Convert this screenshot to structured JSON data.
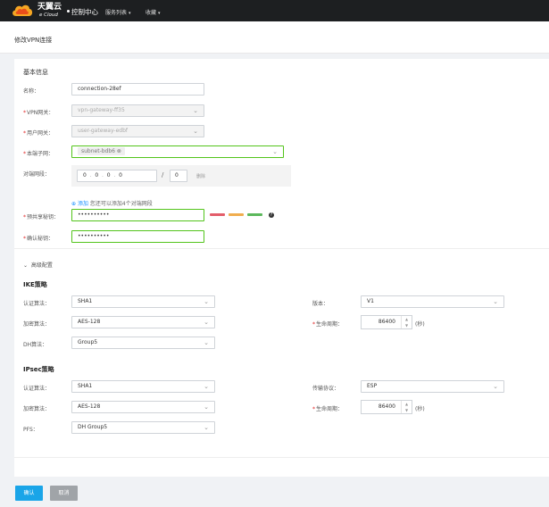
{
  "topbar": {
    "logo_cn": "天翼云",
    "logo_en": "e Cloud",
    "console": "控制中心",
    "nav": [
      {
        "label": "服务列表"
      },
      {
        "label": "收藏"
      }
    ]
  },
  "page": {
    "title": "修改VPN连接"
  },
  "basic": {
    "title": "基本信息",
    "name_label": "名称：",
    "name_value": "connection-28ef",
    "vpn_gw_label": "VPN网关：",
    "vpn_gw_value": "vpn-gateway-ff35",
    "user_gw_label": "用户网关：",
    "user_gw_value": "user-gateway-edbf",
    "local_subnet_label": "本端子网：",
    "local_subnet_chip": "subnet-bdb6",
    "local_subnet_chip_close": "⊗",
    "peer_cidr_label": "对端网段：",
    "cidr_octets": [
      "0",
      "0",
      "0",
      "0"
    ],
    "cidr_mask": "0",
    "delete_label": "删除",
    "add_link": "添加",
    "add_hint": "您还可以添加4个对端网段",
    "psk_label": "预共享秘钥：",
    "psk_value": "••••••••••",
    "confirm_label": "确认秘钥：",
    "confirm_value": "••••••••••",
    "help_glyph": "?",
    "strength_colors": [
      "#e35d6a",
      "#f0ad4e",
      "#5cb85c"
    ]
  },
  "advanced": {
    "toggle_label": "高级配置"
  },
  "ike": {
    "title": "IKE策略",
    "auth_label": "认证算法：",
    "auth_value": "SHA1",
    "version_label": "版本：",
    "version_value": "V1",
    "enc_label": "加密算法：",
    "enc_value": "AES-128",
    "lifetime_label": "生命周期：",
    "lifetime_value": "86400",
    "lifetime_unit": "(秒)",
    "dh_label": "DH算法：",
    "dh_value": "Group5"
  },
  "ipsec": {
    "title": "IPsec策略",
    "auth_label": "认证算法：",
    "auth_value": "SHA1",
    "proto_label": "传输协议：",
    "proto_value": "ESP",
    "enc_label": "加密算法：",
    "enc_value": "AES-128",
    "lifetime_label": "生命周期：",
    "lifetime_value": "86400",
    "lifetime_unit": "(秒)",
    "pfs_label": "PFS：",
    "pfs_value": "DH Group5"
  },
  "footer": {
    "confirm_label": "确认",
    "cancel_label": "取消"
  }
}
